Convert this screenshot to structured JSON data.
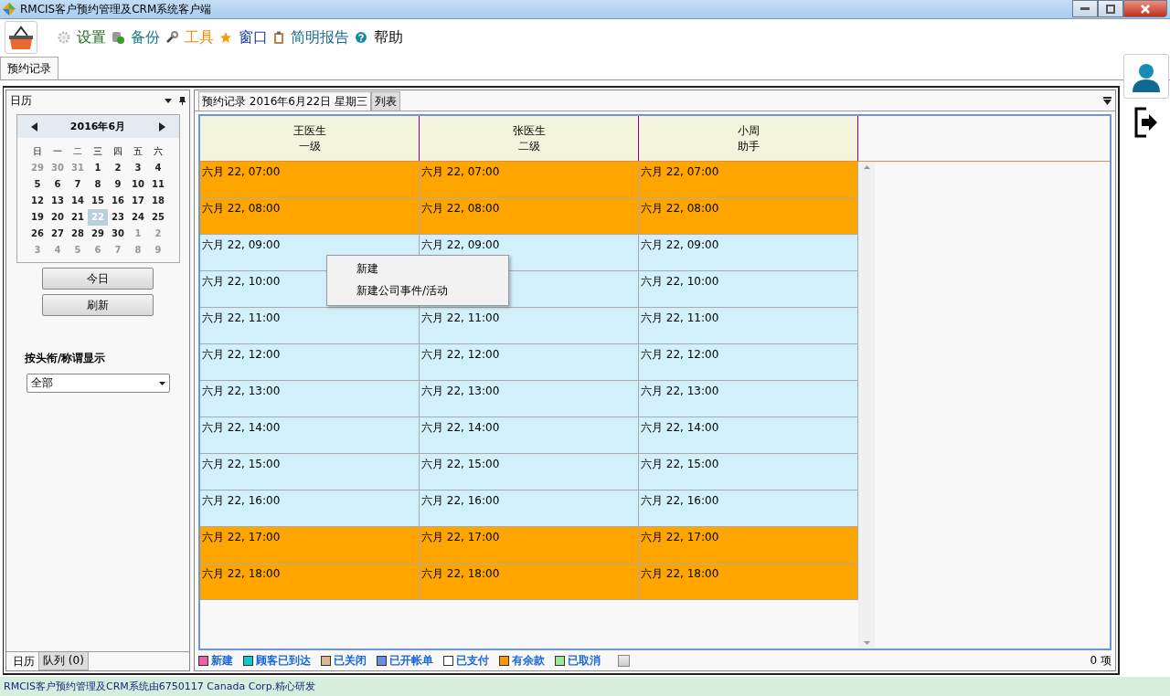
{
  "window": {
    "title": "RMCIS客户预约管理及CRM系统客户端"
  },
  "menu": [
    {
      "label": "设置",
      "color": "#1f6b1f"
    },
    {
      "label": "备份",
      "color": "#1a7a8a"
    },
    {
      "label": "工具",
      "color": "#f08a00"
    },
    {
      "label": "窗口",
      "color": "#1a3fbf"
    },
    {
      "label": "简明报告",
      "color": "#1a6a8a"
    },
    {
      "label": "帮助",
      "color": "#111111"
    }
  ],
  "tabs": [
    {
      "label": "预约记录",
      "selected": true
    }
  ],
  "calendar_panel": {
    "title": "日历",
    "month": "2016年6月",
    "weekdays": [
      "日",
      "一",
      "二",
      "三",
      "四",
      "五",
      "六"
    ],
    "weeks": [
      [
        {
          "day": "29",
          "outside": true,
          "selected": false
        },
        {
          "day": "30",
          "outside": true,
          "selected": false
        },
        {
          "day": "31",
          "outside": true,
          "selected": false
        },
        {
          "day": "1",
          "outside": false,
          "selected": false
        },
        {
          "day": "2",
          "outside": false,
          "selected": false
        },
        {
          "day": "3",
          "outside": false,
          "selected": false
        },
        {
          "day": "4",
          "outside": false,
          "selected": false
        }
      ],
      [
        {
          "day": "5",
          "outside": false,
          "selected": false
        },
        {
          "day": "6",
          "outside": false,
          "selected": false
        },
        {
          "day": "7",
          "outside": false,
          "selected": false
        },
        {
          "day": "8",
          "outside": false,
          "selected": false
        },
        {
          "day": "9",
          "outside": false,
          "selected": false
        },
        {
          "day": "10",
          "outside": false,
          "selected": false
        },
        {
          "day": "11",
          "outside": false,
          "selected": false
        }
      ],
      [
        {
          "day": "12",
          "outside": false,
          "selected": false
        },
        {
          "day": "13",
          "outside": false,
          "selected": false
        },
        {
          "day": "14",
          "outside": false,
          "selected": false
        },
        {
          "day": "15",
          "outside": false,
          "selected": false
        },
        {
          "day": "16",
          "outside": false,
          "selected": false
        },
        {
          "day": "17",
          "outside": false,
          "selected": false
        },
        {
          "day": "18",
          "outside": false,
          "selected": false
        }
      ],
      [
        {
          "day": "19",
          "outside": false,
          "selected": false
        },
        {
          "day": "20",
          "outside": false,
          "selected": false
        },
        {
          "day": "21",
          "outside": false,
          "selected": false
        },
        {
          "day": "22",
          "outside": false,
          "selected": true
        },
        {
          "day": "23",
          "outside": false,
          "selected": false
        },
        {
          "day": "24",
          "outside": false,
          "selected": false
        },
        {
          "day": "25",
          "outside": false,
          "selected": false
        }
      ],
      [
        {
          "day": "26",
          "outside": false,
          "selected": false
        },
        {
          "day": "27",
          "outside": false,
          "selected": false
        },
        {
          "day": "28",
          "outside": false,
          "selected": false
        },
        {
          "day": "29",
          "outside": false,
          "selected": false
        },
        {
          "day": "30",
          "outside": false,
          "selected": false
        },
        {
          "day": "1",
          "outside": true,
          "selected": false
        },
        {
          "day": "2",
          "outside": true,
          "selected": false
        }
      ],
      [
        {
          "day": "3",
          "outside": true,
          "selected": false
        },
        {
          "day": "4",
          "outside": true,
          "selected": false
        },
        {
          "day": "5",
          "outside": true,
          "selected": false
        },
        {
          "day": "6",
          "outside": true,
          "selected": false
        },
        {
          "day": "7",
          "outside": true,
          "selected": false
        },
        {
          "day": "8",
          "outside": true,
          "selected": false
        },
        {
          "day": "9",
          "outside": true,
          "selected": false
        }
      ]
    ],
    "buttons": [
      "今日",
      "刷新"
    ],
    "filter_label": "按头衔/称谓显示",
    "filter_value": "全部",
    "bottom_tabs": [
      {
        "label": "日历",
        "selected": true
      },
      {
        "label": "队列 (0)",
        "selected": false
      }
    ]
  },
  "schedule": {
    "tabs": [
      {
        "label": "预约记录 2016年6月22日 星期三",
        "selected": true
      },
      {
        "label": "列表",
        "selected": false
      }
    ],
    "columns": [
      {
        "name": "王医生",
        "title": "一级"
      },
      {
        "name": "张医生",
        "title": "二级"
      },
      {
        "name": "小周",
        "title": "助手"
      }
    ],
    "rows": [
      {
        "kind": "off",
        "cells": [
          "六月 22, 07:00",
          "六月 22, 07:00",
          "六月 22, 07:00"
        ]
      },
      {
        "kind": "off",
        "cells": [
          "六月 22, 08:00",
          "六月 22, 08:00",
          "六月 22, 08:00"
        ]
      },
      {
        "kind": "open",
        "cells": [
          "六月 22, 09:00",
          "六月 22, 09:00",
          "六月 22, 09:00"
        ]
      },
      {
        "kind": "open",
        "cells": [
          "六月 22, 10:00",
          null,
          "六月 22, 10:00"
        ]
      },
      {
        "kind": "open",
        "cells": [
          "六月 22, 11:00",
          "六月 22, 11:00",
          "六月 22, 11:00"
        ]
      },
      {
        "kind": "open",
        "cells": [
          "六月 22, 12:00",
          "六月 22, 12:00",
          "六月 22, 12:00"
        ]
      },
      {
        "kind": "open",
        "cells": [
          "六月 22, 13:00",
          "六月 22, 13:00",
          "六月 22, 13:00"
        ]
      },
      {
        "kind": "open",
        "cells": [
          "六月 22, 14:00",
          "六月 22, 14:00",
          "六月 22, 14:00"
        ]
      },
      {
        "kind": "open",
        "cells": [
          "六月 22, 15:00",
          "六月 22, 15:00",
          "六月 22, 15:00"
        ]
      },
      {
        "kind": "open",
        "cells": [
          "六月 22, 16:00",
          "六月 22, 16:00",
          "六月 22, 16:00"
        ]
      },
      {
        "kind": "off",
        "cells": [
          "六月 22, 17:00",
          "六月 22, 17:00",
          "六月 22, 17:00"
        ]
      },
      {
        "kind": "off",
        "cells": [
          "六月 22, 18:00",
          "六月 22, 18:00",
          "六月 22, 18:00"
        ]
      }
    ],
    "context_menu": [
      "新建",
      "新建公司事件/活动"
    ],
    "legend": [
      {
        "label": "新建",
        "color": "#f060a8"
      },
      {
        "label": "顾客已到达",
        "color": "#10c8c8"
      },
      {
        "label": "已关闭",
        "color": "#d8b890"
      },
      {
        "label": "已开帐单",
        "color": "#6890e0"
      },
      {
        "label": "已支付",
        "color": "#ffffff"
      },
      {
        "label": "有余款",
        "color": "#ff9800"
      },
      {
        "label": "已取消",
        "color": "#98e898"
      }
    ],
    "show_all_checked": false,
    "count": "0 项"
  },
  "status_bar": "RMCIS客户预约管理及CRM系统由6750117 Canada Corp.精心研发"
}
